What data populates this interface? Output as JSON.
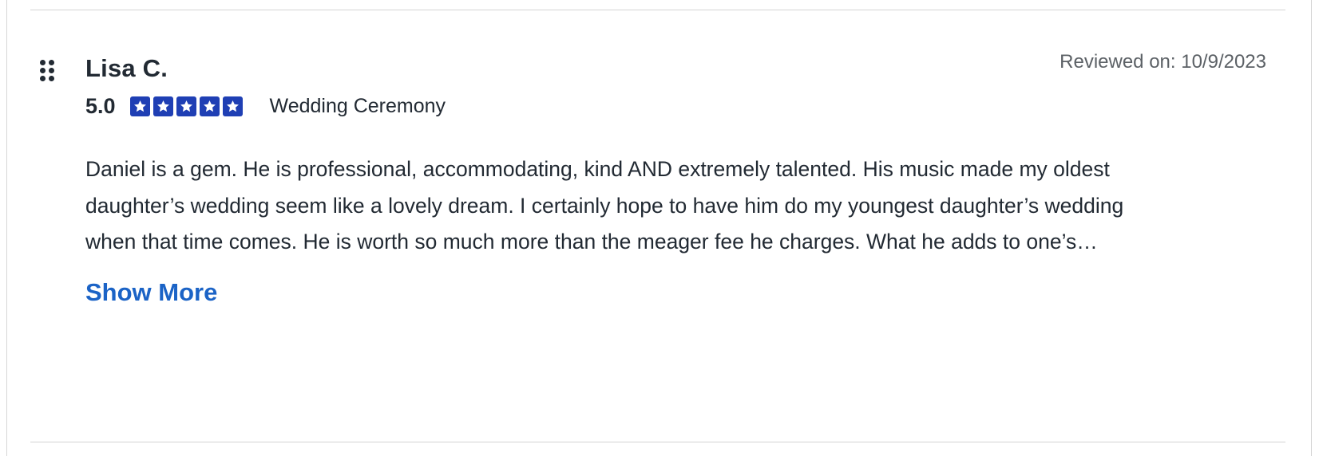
{
  "review": {
    "reviewer_name": "Lisa C.",
    "reviewed_on": "Reviewed on: 10/9/2023",
    "rating_value": "5.0",
    "rating_stars": 5,
    "rating_max": 5,
    "event_type": "Wedding Ceremony",
    "text_lines": [
      "Daniel is a gem. He is professional, accommodating, kind AND extremely talented. His music made my oldest",
      "daughter’s wedding seem like a lovely dream. I certainly hope to have him do my youngest daughter’s wedding",
      "when that time comes. He is worth so much more than the meager fee he charges. What he adds to one’s…"
    ],
    "show_more_label": "Show More"
  },
  "colors": {
    "star_fill": "#1f3fb4",
    "link": "#1b63c6",
    "text": "#222a33",
    "muted": "#5c6166"
  }
}
